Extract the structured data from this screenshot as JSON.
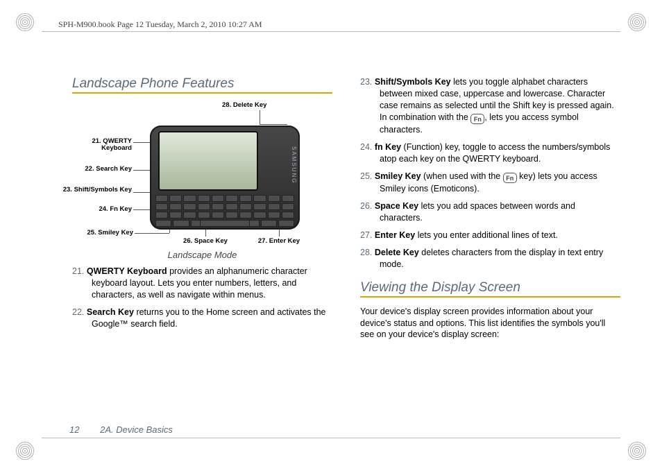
{
  "meta_line": "SPH-M900.book  Page 12  Tuesday, March 2, 2010  10:27 AM",
  "section1_title": "Landscape Phone Features",
  "section2_title": "Viewing the Display Screen",
  "figure": {
    "caption": "Landscape Mode",
    "brand": "SAMSUNG",
    "callouts": {
      "c21": "21. QWERTY Keyboard",
      "c22": "22. Search Key",
      "c23": "23. Shift/Symbols Key",
      "c24": "24. Fn Key",
      "c25": "25. Smiley Key",
      "c26": "26. Space Key",
      "c27": "27. Enter Key",
      "c28": "28. Delete Key"
    }
  },
  "left_items": [
    {
      "num": "21.",
      "term": "QWERTY Keyboard",
      "rest": " provides an alphanumeric character keyboard layout. Lets you enter numbers, letters, and characters, as well as navigate within menus."
    },
    {
      "num": "22.",
      "term": "Search Key",
      "rest": " returns you to the Home screen and activates the Google™ search field."
    }
  ],
  "right_items": [
    {
      "num": "23.",
      "term": "Shift/Symbols Key",
      "pre": " lets you toggle alphabet characters between mixed case, uppercase and lowercase. Character case remains as selected until the Shift key is pressed again. In combination with the ",
      "icon": "Fn",
      "post": ", lets you access symbol characters."
    },
    {
      "num": "24.",
      "term": "fn Key",
      "rest": " (Function) key, toggle to access the numbers/symbols atop each key on the QWERTY keyboard."
    },
    {
      "num": "25.",
      "term": "Smiley Key",
      "pre": " (when used with the ",
      "icon": "Fn",
      "post": " key) lets you access Smiley icons (Emoticons)."
    },
    {
      "num": "26.",
      "term": "Space Key",
      "rest": " lets you add spaces between words and characters."
    },
    {
      "num": "27.",
      "term": "Enter Key",
      "rest": " lets you enter additional lines of text."
    },
    {
      "num": "28.",
      "term": "Delete Key",
      "rest": " deletes characters from the display in text entry mode."
    }
  ],
  "section2_intro": "Your device's display screen provides information about your device's status and options. This list identifies the symbols you'll see on your device's display screen:",
  "footer": {
    "page": "12",
    "chapter": "2A. Device Basics"
  }
}
